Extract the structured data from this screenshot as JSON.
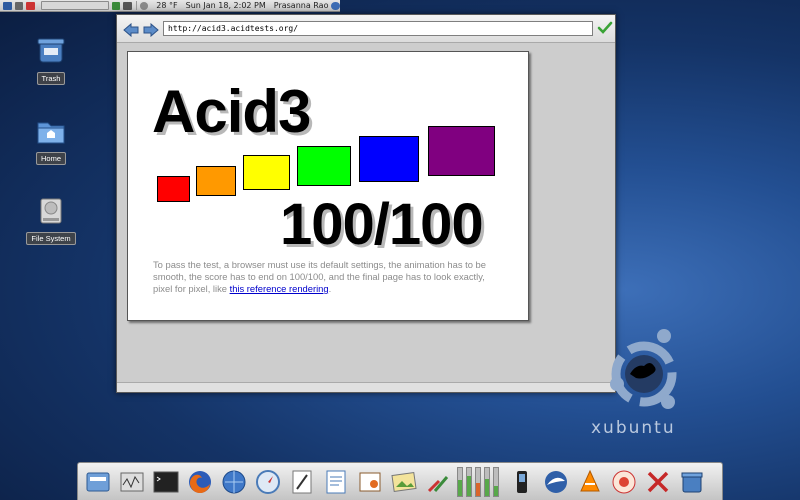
{
  "top_panel": {
    "temperature": "28 °F",
    "datetime": "Sun Jan 18,  2:02 PM",
    "user": "Prasanna Rao"
  },
  "desktop": {
    "icons": [
      {
        "label": "Trash"
      },
      {
        "label": "Home"
      },
      {
        "label": "File System"
      }
    ]
  },
  "browser": {
    "url": "http://acid3.acidtests.org/",
    "page": {
      "title": "Acid3",
      "score": "100/100",
      "description": "To pass the test, a browser must use its default settings, the animation has to be smooth, the score has to end on 100/100, and the final page has to look exactly, pixel for pixel, like ",
      "link_text": "this reference rendering",
      "description_end": ".",
      "boxes": [
        {
          "color": "#ff0000"
        },
        {
          "color": "#ff9900"
        },
        {
          "color": "#ffff00"
        },
        {
          "color": "#00ff00"
        },
        {
          "color": "#0000ff"
        },
        {
          "color": "#800080"
        }
      ]
    }
  },
  "brand": {
    "logo_text": "xubuntu"
  },
  "dock": {
    "apps": [
      "file-manager-icon",
      "system-monitor-icon",
      "terminal-icon",
      "firefox-icon",
      "web-browser-icon",
      "safari-icon",
      "text-editor-icon",
      "office-writer-icon",
      "office-impress-icon",
      "image-viewer-icon",
      "settings-icon",
      "meter-1",
      "meter-2",
      "meter-3",
      "meter-4",
      "meter-5",
      "phone-icon",
      "thunderbird-icon",
      "vlc-icon",
      "screensaver-icon",
      "xfce-x-icon",
      "trash-icon"
    ],
    "meter_levels": [
      0.55,
      0.7,
      0.45,
      0.6,
      0.35
    ]
  }
}
